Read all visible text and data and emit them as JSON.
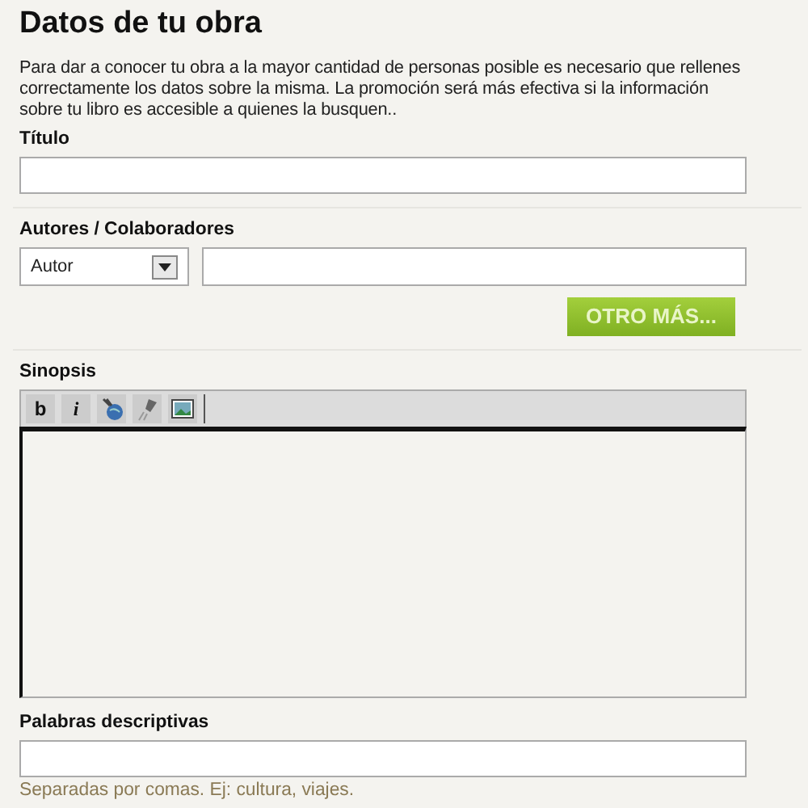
{
  "heading": "Datos de tu obra",
  "intro": "Para dar a conocer tu obra a la mayor cantidad de personas posible es necesario que rellenes correctamente los datos sobre la misma. La promoción será más efectiva si la información sobre tu libro es accesible a quienes la busquen..",
  "title_field": {
    "label": "Título"
  },
  "authors": {
    "label": "Autores / Colaboradores",
    "role": "Autor",
    "add_button": "OTRO MÁS..."
  },
  "synopsis": {
    "label": "Sinopsis",
    "toolbar": [
      {
        "kind": "bold",
        "label": "b"
      },
      {
        "kind": "italic",
        "label": "i"
      },
      {
        "kind": "globe"
      },
      {
        "kind": "unlink"
      },
      {
        "kind": "image"
      }
    ]
  },
  "keywords": {
    "label": "Palabras descriptivas",
    "hint": "Separadas por comas. Ej: cultura, viajes."
  }
}
